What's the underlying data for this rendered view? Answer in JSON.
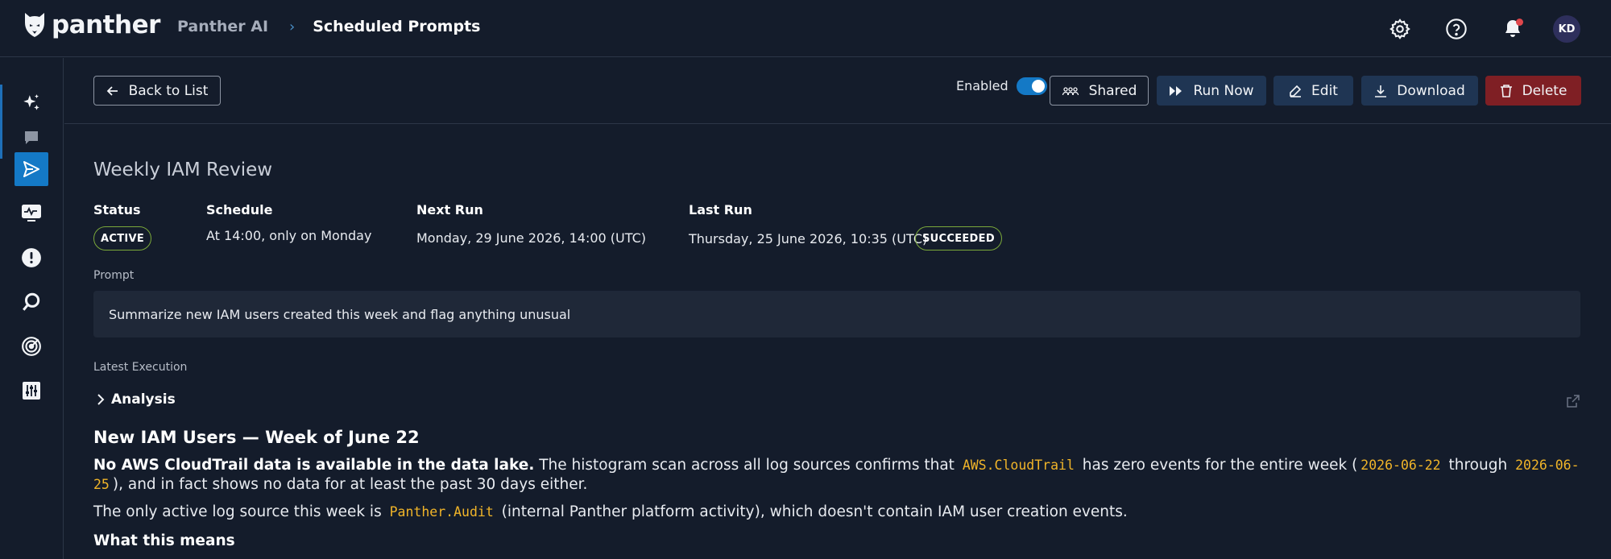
{
  "app": {
    "logo_text": "panther",
    "breadcrumb": {
      "parent": "Panther AI",
      "current": "Scheduled Prompts"
    },
    "user_initials": "KD"
  },
  "colors": {
    "background": "#141c2b",
    "accent": "#1479c6",
    "secondary_button": "#1f3553",
    "danger": "#7f1f24",
    "success_border": "#7aa83a",
    "code": "#f0b429"
  },
  "nav": {
    "items": [
      {
        "name": "sparkles-icon",
        "active": false
      },
      {
        "name": "chat-icon",
        "active": false
      },
      {
        "name": "send-icon",
        "active": true
      },
      {
        "name": "monitor-icon",
        "active": false
      },
      {
        "name": "alert-icon",
        "active": false
      },
      {
        "name": "search-icon",
        "active": false
      },
      {
        "name": "target-icon",
        "active": false
      },
      {
        "name": "sliders-icon",
        "active": false
      }
    ]
  },
  "toolbar": {
    "back_label": "Back to List",
    "enabled_label": "Enabled",
    "enabled": true,
    "shared_label": "Shared",
    "run_label": "Run Now",
    "edit_label": "Edit",
    "download_label": "Download",
    "delete_label": "Delete"
  },
  "prompt_detail": {
    "title": "Weekly IAM Review",
    "status_label": "Status",
    "status_value": "ACTIVE",
    "schedule_label": "Schedule",
    "schedule_value": "At 14:00, only on Monday",
    "next_run_label": "Next Run",
    "next_run_value": "Monday, 29 June 2026, 14:00 (UTC)",
    "last_run_label": "Last Run",
    "last_run_value": "Thursday, 25 June 2026, 10:35 (UTC)",
    "last_run_status": "SUCCEEDED",
    "prompt_label": "Prompt",
    "prompt_text": "Summarize new IAM users created this week and flag anything unusual"
  },
  "execution": {
    "section_label": "Latest Execution",
    "analysis_label": "Analysis",
    "heading": "New IAM Users — Week of June 22",
    "p1_bold": "No AWS CloudTrail data is available in the data lake.",
    "p1_a": " The histogram scan across all log sources confirms that ",
    "p1_code1": "AWS.CloudTrail",
    "p1_b": " has zero events for the entire week (",
    "p1_code2": "2026-06-22",
    "p1_c": " through ",
    "p1_code3": "2026-06-25",
    "p1_d": "), and in fact shows no data for at least the past 30 days either.",
    "p2_a": "The only active log source this week is ",
    "p2_code": "Panther.Audit",
    "p2_b": " (internal Panther platform activity), which doesn't contain IAM user creation events.",
    "subheading": "What this means"
  }
}
